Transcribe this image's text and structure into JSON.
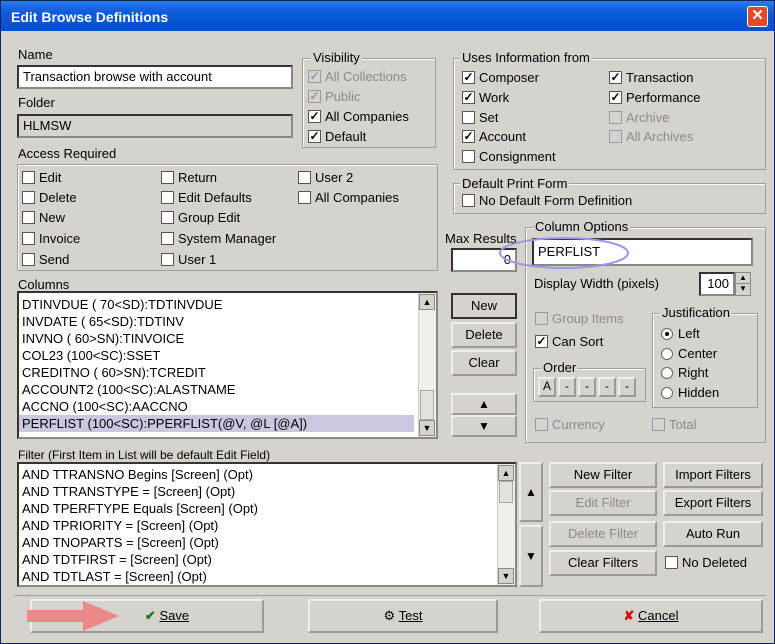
{
  "title": "Edit Browse Definitions",
  "close_glyph": "✕",
  "name": {
    "label": "Name",
    "value": "Transaction browse with account"
  },
  "folder": {
    "label": "Folder",
    "value": "HLMSW"
  },
  "visibility": {
    "label": "Visibility",
    "items": [
      {
        "label": "All Collections",
        "checked": true,
        "disabled": true
      },
      {
        "label": "Public",
        "checked": true,
        "disabled": true
      },
      {
        "label": "All Companies",
        "checked": true,
        "disabled": false
      },
      {
        "label": "Default",
        "checked": true,
        "disabled": false
      }
    ]
  },
  "uses_info": {
    "label": "Uses Information from",
    "items": [
      {
        "label": "Composer",
        "checked": true
      },
      {
        "label": "Work",
        "checked": true
      },
      {
        "label": "Set",
        "checked": false
      },
      {
        "label": "Account",
        "checked": true
      },
      {
        "label": "Consignment",
        "checked": false
      },
      {
        "label": "Transaction",
        "checked": true
      },
      {
        "label": "Performance",
        "checked": true
      },
      {
        "label": "Archive",
        "checked": false,
        "disabled": true
      },
      {
        "label": "All Archives",
        "checked": false,
        "disabled": true
      }
    ]
  },
  "access": {
    "label": "Access Required",
    "items": [
      "Edit",
      "Delete",
      "New",
      "Invoice",
      "Send",
      "Return",
      "Edit Defaults",
      "Group Edit",
      "System Manager",
      "User 1",
      "User 2",
      "All Companies"
    ]
  },
  "print_form": {
    "label": "Default Print Form",
    "item": "No Default Form Definition"
  },
  "max_results": {
    "label": "Max Results",
    "value": "0"
  },
  "column_options": {
    "label": "Column Options",
    "value": "PERFLIST",
    "display_width_label": "Display Width (pixels)",
    "display_width": "100",
    "group_items": "Group Items",
    "can_sort": "Can Sort",
    "order_label": "Order",
    "order_buttons": [
      "A",
      "-",
      "-",
      "-",
      "-"
    ],
    "justification_label": "Justification",
    "justification": [
      "Left",
      "Center",
      "Right",
      "Hidden"
    ],
    "currency": "Currency",
    "total": "Total"
  },
  "columns": {
    "label": "Columns",
    "items": [
      "DTINVDUE ( 70<SD):TDTINVDUE",
      "INVDATE ( 65<SD):TDTINV",
      "INVNO ( 60>SN):TINVOICE",
      "COL23 (100<SC):SSET",
      "CREDITNO ( 60>SN):TCREDIT",
      "ACCOUNT2 (100<SC):ALASTNAME",
      "ACCNO (100<SC):AACCNO",
      "PERFLIST (100<SC):PPERFLIST(@V, @L [@A])"
    ]
  },
  "col_buttons": {
    "new": "New",
    "delete": "Delete",
    "clear": "Clear"
  },
  "filter": {
    "label": "Filter (First Item in List will  be default Edit Field)",
    "items": [
      "AND TTRANSNO  Begins [Screen] (Opt)",
      "AND TTRANSTYPE  = [Screen] (Opt)",
      "AND TPERFTYPE  Equals [Screen] (Opt)",
      "AND TPRIORITY  = [Screen] (Opt)",
      "AND TNOPARTS  = [Screen] (Opt)",
      "AND TDTFIRST  = [Screen] (Opt)",
      "AND TDTLAST  = [Screen] (Opt)"
    ]
  },
  "filter_buttons": {
    "new_filter": "New Filter",
    "import_filters": "Import Filters",
    "edit_filter": "Edit Filter",
    "export_filters": "Export Filters",
    "delete_filter": "Delete Filter",
    "auto_run": "Auto Run",
    "clear_filters": "Clear Filters",
    "no_deleted": "No Deleted"
  },
  "footer": {
    "save": "Save",
    "test": "Test",
    "cancel": "Cancel"
  }
}
